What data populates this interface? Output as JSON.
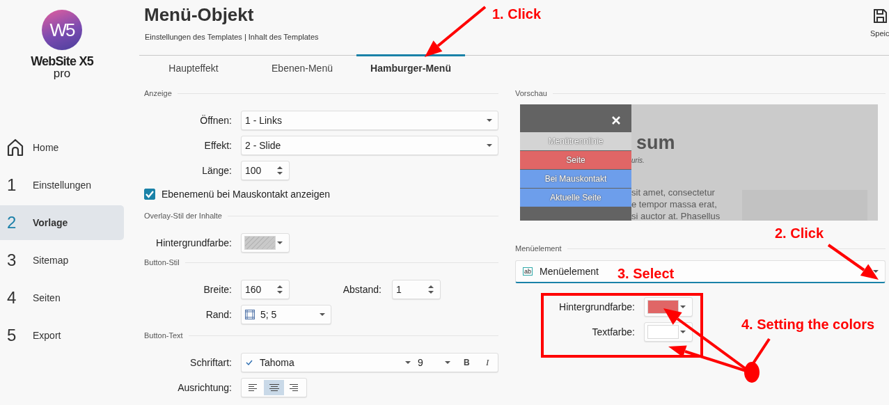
{
  "logo": {
    "mark": "W5",
    "name": "WebSite X5",
    "edition": "pro"
  },
  "sidebar": {
    "items": [
      {
        "kind": "home",
        "label": "Home",
        "selected": false
      },
      {
        "kind": "step",
        "number": "1",
        "label": "Einstellungen",
        "selected": false
      },
      {
        "kind": "step",
        "number": "2",
        "label": "Vorlage",
        "selected": true
      },
      {
        "kind": "step",
        "number": "3",
        "label": "Sitemap",
        "selected": false
      },
      {
        "kind": "step",
        "number": "4",
        "label": "Seiten",
        "selected": false
      },
      {
        "kind": "step",
        "number": "5",
        "label": "Export",
        "selected": false
      }
    ]
  },
  "header": {
    "title": "Menü-Objekt",
    "breadcrumb": "Einstellungen des Templates | Inhalt des Templates",
    "save_label": "Speic"
  },
  "tabs": [
    {
      "label": "Haupteffekt",
      "selected": false
    },
    {
      "label": "Ebenen-Menü",
      "selected": false
    },
    {
      "label": "Hamburger-Menü",
      "selected": true
    }
  ],
  "display": {
    "title": "Anzeige",
    "fields": [
      {
        "kind": "select",
        "label": "Öffnen:",
        "value": "1 - Links"
      },
      {
        "kind": "select",
        "label": "Effekt:",
        "value": "2 - Slide"
      },
      {
        "kind": "spin",
        "label": "Länge:",
        "value": "100"
      }
    ],
    "checkbox": {
      "label": "Ebenemenü bei Mauskontakt anzeigen",
      "checked": true
    }
  },
  "overlay": {
    "title": "Overlay-Stil der Inhalte",
    "label": "Hintergrundfarbe:"
  },
  "button_style": {
    "title": "Button-Stil",
    "width_label": "Breite:",
    "width_value": "160",
    "spacing_label": "Abstand:",
    "spacing_value": "1",
    "border_label": "Rand:",
    "border_value": "5; 5"
  },
  "button_text": {
    "title": "Button-Text",
    "font_label": "Schriftart:",
    "font": "Tahoma",
    "size": "9",
    "bold_label": "B",
    "italic_label": "I",
    "align_label": "Ausrichtung:",
    "alignments": [
      {
        "kind": "left",
        "selected": false
      },
      {
        "kind": "center",
        "selected": true
      },
      {
        "kind": "right",
        "selected": false
      }
    ]
  },
  "preview": {
    "title": "Vorschau",
    "heading": "sum",
    "subtitle": "uris.",
    "body_lines": [
      "sit amet, consectetur",
      "e tempor massa erat,",
      "si auctor at. Phasellus"
    ],
    "menu_items": [
      {
        "label": "Menütrennlinie",
        "color": "#d4d4d4"
      },
      {
        "label": "Seite",
        "color": "#e06666"
      },
      {
        "label": "Bei Mauskontakt",
        "color": "#6d9eeb"
      },
      {
        "label": "Aktuelle Seite",
        "color": "#6d9eeb"
      }
    ]
  },
  "menu_element": {
    "title": "Menüelement",
    "icon_text": "ab",
    "value": "Menüelement",
    "colors": [
      {
        "label": "Hintergrundfarbe:",
        "color": "#e06666"
      },
      {
        "label": "Textfarbe:",
        "color": "#ffffff"
      }
    ]
  },
  "annotations": [
    {
      "text": "1. Click"
    },
    {
      "text": "2. Click"
    },
    {
      "text": "3. Select"
    },
    {
      "text": "4. Setting the colors"
    }
  ]
}
